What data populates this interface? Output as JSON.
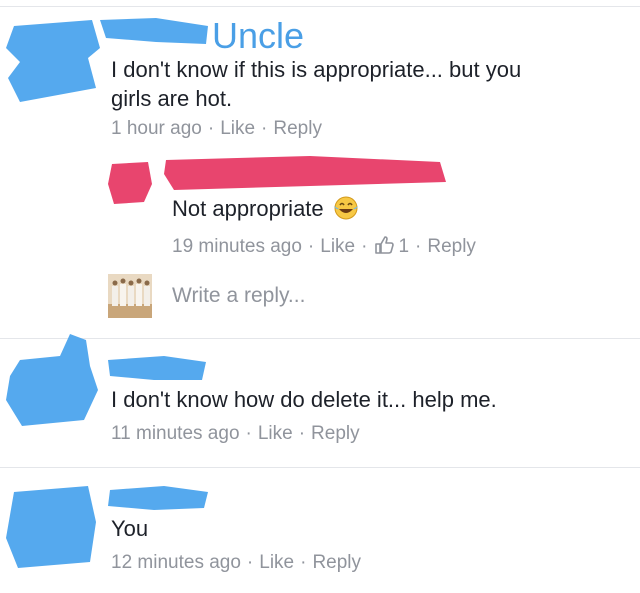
{
  "comments": [
    {
      "author_label": "Uncle",
      "text_lines": [
        "I don't know if this is appropriate... but you",
        "girls are hot."
      ],
      "time": "1 hour ago",
      "like": "Like",
      "reply": "Reply"
    },
    {
      "text": "Not appropriate",
      "emoji": "laughing-crying-emoji",
      "time": "19 minutes ago",
      "like": "Like",
      "reaction_count": "1",
      "reply": "Reply"
    },
    {
      "text": "I don't know how do delete it... help me.",
      "time": "11 minutes ago",
      "like": "Like",
      "reply": "Reply"
    },
    {
      "text": "You",
      "time": "12 minutes ago",
      "like": "Like",
      "reply": "Reply"
    }
  ],
  "reply_input": {
    "placeholder": "Write a reply..."
  },
  "colors": {
    "redaction_blue": "#55a9ee",
    "redaction_pink": "#e8456e",
    "meta_gray": "#90949c",
    "uncle_blue": "#4a9fe6"
  }
}
